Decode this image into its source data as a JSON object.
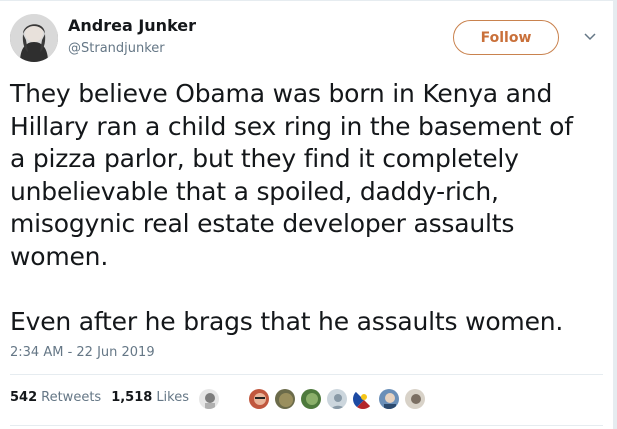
{
  "author": {
    "name": "Andrea Junker",
    "handle": "@Strandjunker",
    "avatar_icon": "avatar-photo"
  },
  "follow_button": {
    "label": "Follow",
    "color": "#c9703a"
  },
  "menu": {
    "icon": "chevron-down-icon"
  },
  "tweet": {
    "text": "They believe Obama was born in Kenya and\nHillary ran a child sex ring in the basement of\na pizza parlor, but they find it completely\nunbelievable that a spoiled, daddy-rich,\nmisogynic real estate developer assaults\nwomen.\n\nEven after he brags that he assaults women.",
    "timestamp": "2:34 AM - 22 Jun 2019"
  },
  "stats": {
    "retweets": {
      "count": "542",
      "label": "Retweets"
    },
    "likes": {
      "count": "1,518",
      "label": "Likes"
    }
  },
  "likers": [
    {
      "color": "#9aa0a6"
    },
    {
      "color": "#c0573e"
    },
    {
      "color": "#6b6b4a"
    },
    {
      "color": "#4e7a3c"
    },
    {
      "color": "#ccd6dd"
    },
    {
      "color": "#b3262c"
    },
    {
      "color": "#6a8fb8"
    },
    {
      "color": "#d8d2c8"
    }
  ]
}
